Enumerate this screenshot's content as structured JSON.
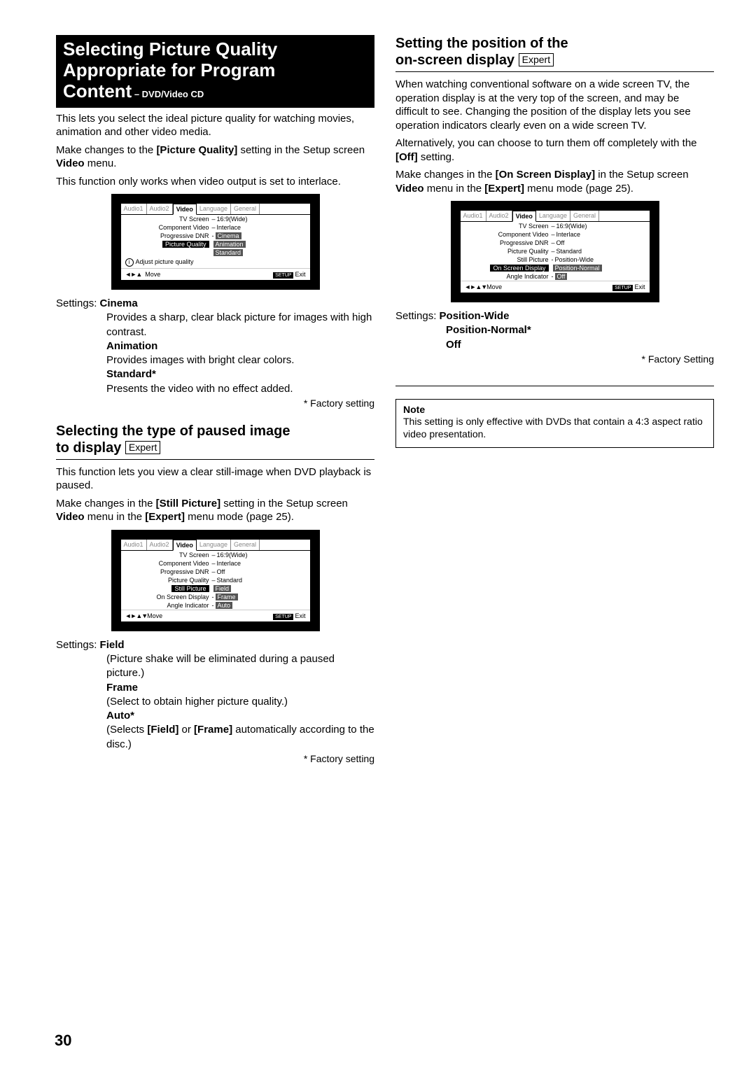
{
  "page_number": "30",
  "left": {
    "sec1": {
      "title1": "Selecting Picture Quality",
      "title2": "Appropriate for Program",
      "title3a": "Content",
      "title3b": " – DVD/Video CD",
      "p1": "This lets you select the ideal picture quality for watching movies, animation and other video media.",
      "p2a": "Make changes to the ",
      "p2b": "[Picture Quality]",
      "p2c": " setting in the Setup screen ",
      "p2d": "Video",
      "p2e": " menu.",
      "p3": "This function only works when video output is set to interlace.",
      "osd": {
        "tabs": [
          "Audio1",
          "Audio2",
          "Video",
          "Language",
          "General"
        ],
        "rows": [
          {
            "label": "TV Screen",
            "val": "16:9(Wide)",
            "sel": false
          },
          {
            "label": "Component Video",
            "val": "Interlace",
            "sel": false
          },
          {
            "label": "Progressive DNR",
            "val": "Cinema",
            "sel": false,
            "valSel": true,
            "labelSel": false
          },
          {
            "label": "Picture Quality",
            "val": "Animation",
            "sel": true,
            "valSel": true,
            "labelSel": true
          },
          {
            "label": "",
            "val": "Standard",
            "sel": false,
            "valSel": true,
            "labelSel": false
          }
        ],
        "hint": "Adjust picture quality",
        "move": "Move",
        "setup": "SETUP",
        "exit": "Exit",
        "arrows": "◄►▲"
      },
      "settings": {
        "label": "Settings: ",
        "items": [
          {
            "name": "Cinema",
            "desc": "Provides a sharp, clear black picture for images with high contrast."
          },
          {
            "name": "Animation",
            "desc": "Provides images with bright clear colors."
          },
          {
            "name": "Standard*",
            "desc": "Presents the video with no effect added."
          }
        ],
        "factory": "* Factory setting"
      }
    },
    "sec2": {
      "titleA": "Selecting the type of paused image",
      "titleB": "to display",
      "expert": "Expert",
      "p1": "This function lets you view a clear still-image when DVD playback is paused.",
      "p2a": "Make changes in the ",
      "p2b": "[Still Picture]",
      "p2c": " setting in the Setup screen ",
      "p2d": "Video",
      "p2e": " menu in the ",
      "p2f": "[Expert]",
      "p2g": " menu mode (page 25).",
      "osd": {
        "tabs": [
          "Audio1",
          "Audio2",
          "Video",
          "Language",
          "General"
        ],
        "rows": [
          {
            "label": "TV Screen",
            "val": "16:9(Wide)"
          },
          {
            "label": "Component Video",
            "val": "Interlace"
          },
          {
            "label": "Progressive DNR",
            "val": "Off"
          },
          {
            "label": "Picture Quality",
            "val": "Standard"
          },
          {
            "label": "Still Picture",
            "val": "Field",
            "labelSel": true,
            "valSel": true
          },
          {
            "label": "On Screen Display",
            "val": "Frame",
            "valSel": true
          },
          {
            "label": "Angle Indicator",
            "val": "Auto",
            "valSel": true
          }
        ],
        "move": "Move",
        "setup": "SETUP",
        "exit": "Exit",
        "arrows": "◄►▲▼"
      },
      "settings": {
        "label": "Settings: ",
        "items": [
          {
            "name": "Field",
            "desc": "(Picture shake will be eliminated during a paused picture.)"
          },
          {
            "name": "Frame",
            "desc": "(Select to obtain higher picture quality.)"
          },
          {
            "name": "Auto*",
            "desc_pre": "(Selects ",
            "desc_b1": "[Field]",
            "desc_mid": " or ",
            "desc_b2": "[Frame]",
            "desc_post": " automatically according to the disc.)"
          }
        ],
        "factory": "* Factory setting"
      }
    }
  },
  "right": {
    "sec1": {
      "titleA": "Setting the position of the",
      "titleB": "on-screen display",
      "expert": "Expert",
      "p1": "When watching conventional software on a wide screen TV, the operation display is at the very top of the screen, and may be difficult to see. Changing the position of the display lets you see operation indicators clearly even on a wide screen TV.",
      "p2a": "Alternatively, you can choose to turn them off completely with the ",
      "p2b": "[Off]",
      "p2c": " setting.",
      "p3a": "Make changes in the ",
      "p3b": "[On Screen Display]",
      "p3c": " in the Setup screen ",
      "p3d": "Video",
      "p3e": " menu in the ",
      "p3f": "[Expert]",
      "p3g": " menu mode (page 25).",
      "osd": {
        "tabs": [
          "Audio1",
          "Audio2",
          "Video",
          "Language",
          "General"
        ],
        "rows": [
          {
            "label": "TV Screen",
            "val": "16:9(Wide)"
          },
          {
            "label": "Component Video",
            "val": "Interlace"
          },
          {
            "label": "Progressive DNR",
            "val": "Off"
          },
          {
            "label": "Picture Quality",
            "val": "Standard"
          },
          {
            "label": "Still Picture",
            "val": "Position-Wide"
          },
          {
            "label": "On Screen Display",
            "val": "Position-Normal",
            "labelSel": true,
            "valSel": true
          },
          {
            "label": "Angle Indicator",
            "val": "Off",
            "valSel": true
          }
        ],
        "move": "Move",
        "setup": "SETUP",
        "exit": "Exit",
        "arrows": "◄►▲▼"
      },
      "settings": {
        "label": "Settings: ",
        "opt1": "Position-Wide",
        "opt2": "Position-Normal*",
        "opt3": "Off",
        "factory": "* Factory Setting"
      },
      "note": {
        "title": "Note",
        "body": "This setting is only effective with DVDs that contain a 4:3 aspect ratio video presentation."
      }
    }
  }
}
